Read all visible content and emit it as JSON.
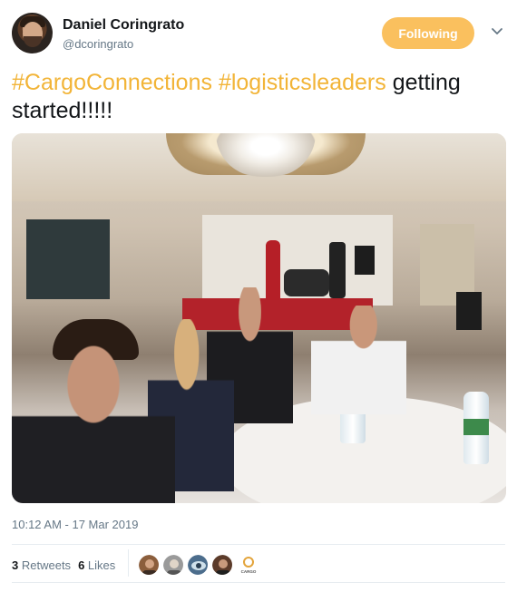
{
  "author": {
    "display_name": "Daniel Coringrato",
    "handle": "@dcoringrato"
  },
  "follow_button": {
    "label": "Following"
  },
  "tweet": {
    "text_parts": [
      {
        "text": "#CargoConnections",
        "type": "hashtag"
      },
      {
        "text": " ",
        "type": "plain"
      },
      {
        "text": "#logisticsleaders",
        "type": "hashtag"
      },
      {
        "text": " getting started!!!!!",
        "type": "plain"
      }
    ],
    "timestamp": "10:12 AM - 17 Mar 2019"
  },
  "stats": {
    "retweets_count": "3",
    "retweets_label": "Retweets",
    "likes_count": "6",
    "likes_label": "Likes"
  },
  "liker_avatars": [
    {
      "name": "liker-avatar-1",
      "color": "#8b5e3c"
    },
    {
      "name": "liker-avatar-2",
      "color": "#9a9a9a"
    },
    {
      "name": "liker-avatar-3",
      "color": "#4c6d8c"
    },
    {
      "name": "liker-avatar-4",
      "color": "#5c3b2a"
    },
    {
      "name": "liker-avatar-5",
      "color": "#e3a43b",
      "logo_text": "CARGO"
    }
  ],
  "colors": {
    "accent": "#fac05e",
    "hashtag": "#f2b437",
    "secondary_text": "#657786"
  },
  "icons": {
    "menu": "chevron-down-icon"
  }
}
